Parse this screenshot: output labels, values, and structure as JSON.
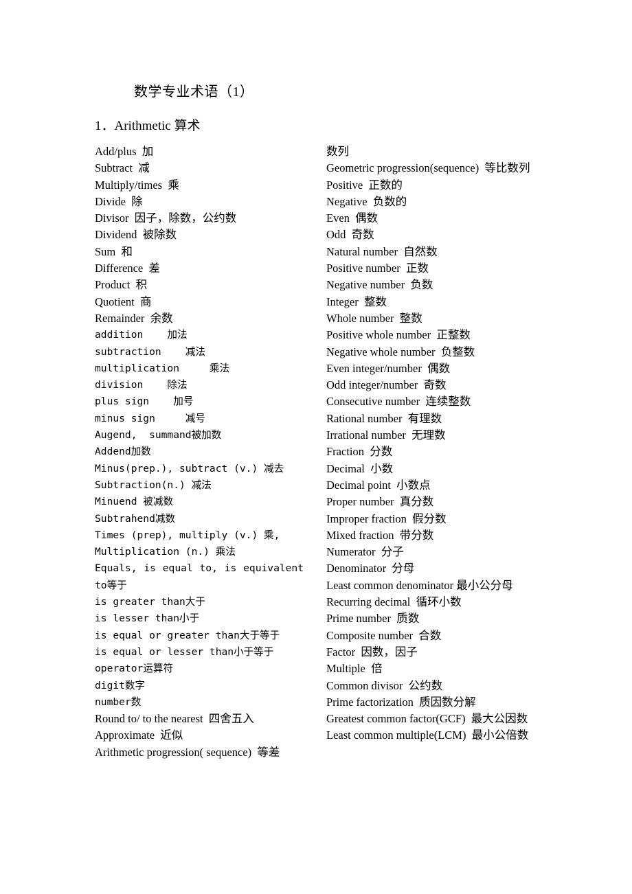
{
  "document": {
    "title": "数学专业术语（1）",
    "section_heading": "1．Arithmetic  算术"
  },
  "columns": {
    "left": [
      {
        "text": "Add/plus  加",
        "style": "serif"
      },
      {
        "text": "Subtract  减",
        "style": "serif"
      },
      {
        "text": "Multiply/times  乘",
        "style": "serif"
      },
      {
        "text": "Divide  除",
        "style": "serif"
      },
      {
        "text": "Divisor  因子，除数，公约数",
        "style": "serif"
      },
      {
        "text": "Dividend  被除数",
        "style": "serif"
      },
      {
        "text": "Sum  和",
        "style": "serif"
      },
      {
        "text": "Difference  差",
        "style": "serif"
      },
      {
        "text": "Product  积",
        "style": "serif"
      },
      {
        "text": "Quotient  商",
        "style": "serif"
      },
      {
        "text": "Remainder  余数",
        "style": "serif"
      },
      {
        "text": "addition    加法",
        "style": "mono"
      },
      {
        "text": "subtraction    减法",
        "style": "mono"
      },
      {
        "text": "multiplication     乘法",
        "style": "mono"
      },
      {
        "text": "division    除法",
        "style": "mono"
      },
      {
        "text": "plus sign    加号",
        "style": "mono"
      },
      {
        "text": "minus sign     减号",
        "style": "mono"
      },
      {
        "text": "Augend,  summand被加数",
        "style": "mono"
      },
      {
        "text": "Addend加数",
        "style": "mono"
      },
      {
        "text": "Minus(prep.), subtract (v.) 减去",
        "style": "mono"
      },
      {
        "text": "Subtraction(n.) 减法",
        "style": "mono"
      },
      {
        "text": "Minuend 被减数",
        "style": "mono"
      },
      {
        "text": "Subtrahend减数",
        "style": "mono"
      },
      {
        "text": "Times (prep), multiply (v.) 乘,",
        "style": "mono"
      },
      {
        "text": "Multiplication (n.) 乘法",
        "style": "mono"
      },
      {
        "text": "Equals, is equal to, is equivalent to等于",
        "style": "mono wrap"
      },
      {
        "text": "is greater than大于",
        "style": "mono"
      },
      {
        "text": "is lesser than小于",
        "style": "mono"
      },
      {
        "text": "is equal or greater than大于等于",
        "style": "mono"
      },
      {
        "text": "is equal or lesser than小于等于",
        "style": "mono"
      },
      {
        "text": "operator运算符",
        "style": "mono"
      },
      {
        "text": "digit数字",
        "style": "mono"
      },
      {
        "text": "number数",
        "style": "mono"
      },
      {
        "text": "Round to/ to the nearest  四舍五入",
        "style": "serif"
      },
      {
        "text": "Approximate  近似",
        "style": "serif"
      },
      {
        "text": "Arithmetic progression( sequence)  等差",
        "style": "serif"
      }
    ],
    "right": [
      {
        "text": "数列",
        "style": "serif"
      },
      {
        "text": "Geometric progression(sequence)  等比数列",
        "style": "serif wrap"
      },
      {
        "text": "Positive  正数的",
        "style": "serif"
      },
      {
        "text": "Negative  负数的",
        "style": "serif"
      },
      {
        "text": "Even  偶数",
        "style": "serif"
      },
      {
        "text": "Odd  奇数",
        "style": "serif"
      },
      {
        "text": "Natural number  自然数",
        "style": "serif"
      },
      {
        "text": "Positive number  正数",
        "style": "serif"
      },
      {
        "text": "Negative number  负数",
        "style": "serif"
      },
      {
        "text": "Integer  整数",
        "style": "serif"
      },
      {
        "text": "Whole number  整数",
        "style": "serif"
      },
      {
        "text": "Positive whole number  正整数",
        "style": "serif"
      },
      {
        "text": "Negative whole number  负整数",
        "style": "serif"
      },
      {
        "text": "Even integer/number  偶数",
        "style": "serif"
      },
      {
        "text": "Odd integer/number  奇数",
        "style": "serif"
      },
      {
        "text": "Consecutive number  连续整数",
        "style": "serif"
      },
      {
        "text": "Rational number  有理数",
        "style": "serif"
      },
      {
        "text": "Irrational number  无理数",
        "style": "serif"
      },
      {
        "text": "Fraction  分数",
        "style": "serif"
      },
      {
        "text": "Decimal  小数",
        "style": "serif"
      },
      {
        "text": "Decimal point  小数点",
        "style": "serif"
      },
      {
        "text": "Proper number  真分数",
        "style": "serif"
      },
      {
        "text": "Improper fraction  假分数",
        "style": "serif"
      },
      {
        "text": "Mixed fraction  带分数",
        "style": "serif"
      },
      {
        "text": "Numerator  分子",
        "style": "serif"
      },
      {
        "text": "Denominator  分母",
        "style": "serif"
      },
      {
        "text": "Least common denominator 最小公分母",
        "style": "serif wrap"
      },
      {
        "text": "Recurring decimal  循环小数",
        "style": "serif"
      },
      {
        "text": "Prime number  质数",
        "style": "serif"
      },
      {
        "text": "Composite number  合数",
        "style": "serif"
      },
      {
        "text": "Factor  因数，因子",
        "style": "serif"
      },
      {
        "text": "Multiple  倍",
        "style": "serif"
      },
      {
        "text": "Common divisor  公约数",
        "style": "serif"
      },
      {
        "text": "Prime factorization  质因数分解",
        "style": "serif"
      },
      {
        "text": "Greatest common factor(GCF)  最大公因数",
        "style": "serif wrap"
      },
      {
        "text": "Least common multiple(LCM)  最小公倍数",
        "style": "serif wrap"
      }
    ]
  }
}
